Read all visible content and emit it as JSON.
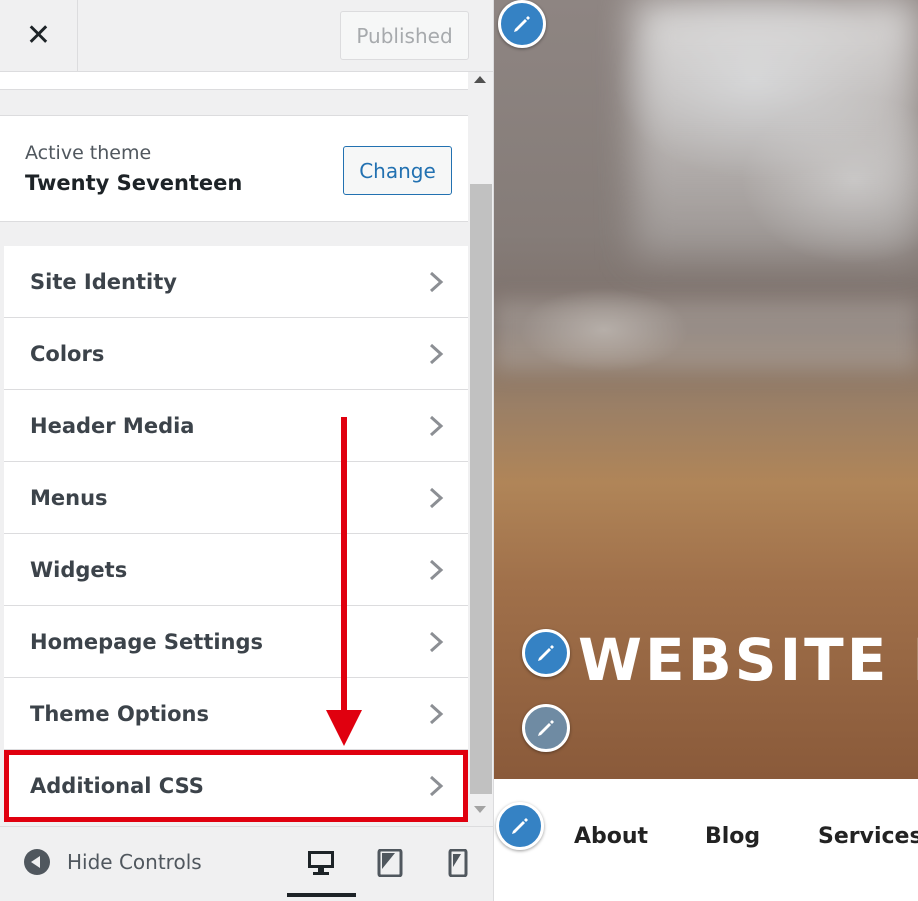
{
  "topbar": {
    "close_symbol": "✕",
    "published_label": "Published"
  },
  "theme": {
    "label": "Active theme",
    "name": "Twenty Seventeen",
    "change_label": "Change"
  },
  "menu": {
    "items": [
      {
        "label": "Site Identity"
      },
      {
        "label": "Colors"
      },
      {
        "label": "Header Media"
      },
      {
        "label": "Menus"
      },
      {
        "label": "Widgets"
      },
      {
        "label": "Homepage Settings"
      },
      {
        "label": "Theme Options"
      },
      {
        "label": "Additional CSS",
        "highlighted": true
      }
    ]
  },
  "footer": {
    "hide_controls_label": "Hide Controls",
    "devices": [
      "desktop-icon",
      "tablet-icon",
      "mobile-icon"
    ],
    "active_device": "desktop"
  },
  "preview": {
    "site_title": "WEBSITE N",
    "nav": [
      "About",
      "Blog",
      "Services"
    ]
  },
  "colors": {
    "accent": "#2271b1",
    "highlight": "#e0000f",
    "edit_button": "#3582c4"
  }
}
